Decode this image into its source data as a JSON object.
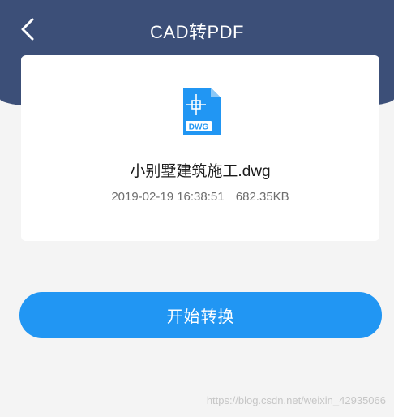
{
  "header": {
    "title": "CAD转PDF",
    "back_icon": "chevron-left-icon"
  },
  "file": {
    "icon": "dwg-file-icon",
    "icon_label": "DWG",
    "name": "小别墅建筑施工.dwg",
    "date": "2019-02-19 16:38:51",
    "size": "682.35KB"
  },
  "actions": {
    "start_label": "开始转换"
  },
  "watermark": "https://blog.csdn.net/weixin_42935066",
  "colors": {
    "header": "#3c4f78",
    "accent": "#2196f3",
    "background": "#f4f4f4"
  }
}
